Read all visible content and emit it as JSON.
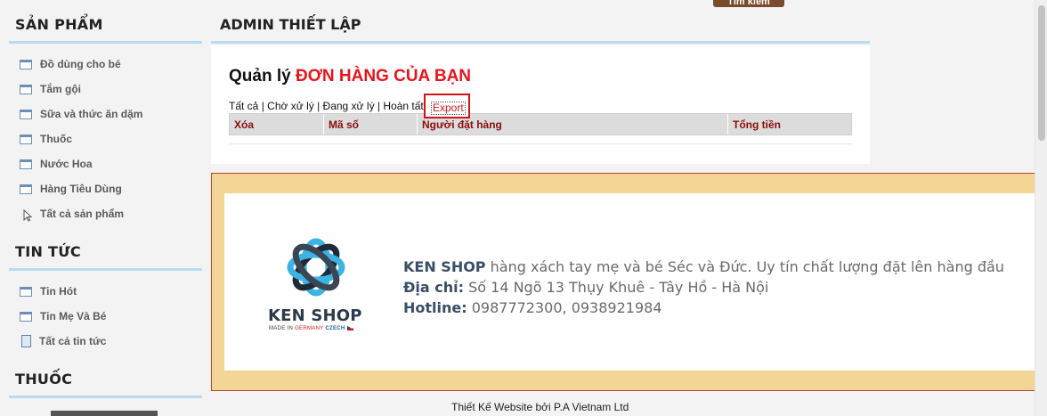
{
  "header": {
    "search_button": "Tìm kiếm"
  },
  "sidebar": {
    "sections": [
      {
        "title": "SẢN PHẨM"
      },
      {
        "title": "TIN TỨC"
      },
      {
        "title": "THUỐC"
      }
    ],
    "products": [
      {
        "label": "Đồ dùng cho bé"
      },
      {
        "label": "Tắm gội"
      },
      {
        "label": "Sữa và thức ăn dặm"
      },
      {
        "label": "Thuốc"
      },
      {
        "label": "Nước Hoa"
      },
      {
        "label": "Hàng Tiêu Dùng"
      }
    ],
    "all_products": "Tất cả sản phẩm",
    "news": [
      {
        "label": "Tin Hót"
      },
      {
        "label": "Tin Mẹ Và Bé"
      }
    ],
    "all_news": "Tất cả tin tức"
  },
  "main": {
    "title": "ADMIN THIẾT LẬP",
    "heading_prefix": "Quản lý",
    "heading_highlight": "ĐƠN HÀNG CỦA BẠN",
    "filters": [
      "Tất cả",
      "Chờ xử lý",
      "Đang xử lý",
      "Hoàn tất"
    ],
    "separator": " | ",
    "export_label": "Export",
    "columns": [
      "Xóa",
      "Mã số",
      "Người đặt hàng",
      "Tổng tiền"
    ]
  },
  "banner": {
    "logo_name": "KEN SHOP",
    "logo_sub_1": "MADE IN",
    "logo_sub_2": "GERMANY",
    "logo_sub_3": "CZECH",
    "shop_name": "KEN SHOP",
    "tagline": " hàng xách tay mẹ và bé Séc và Đức. Uy tín chất lượng đặt lên hàng đầu",
    "address_label": "Địa chỉ:",
    "address": " Số 14 Ngõ 13 Thụy Khuê - Tây Hồ - Hà Nội",
    "hotline_label": "Hotline:",
    "hotline": " 0987772300, 0938921984"
  },
  "footer": {
    "text": "Thiết Kế Website bởi P.A Vietnam Ltd"
  },
  "colors": {
    "accent_red": "#e8141b",
    "section_line": "#b9dbef",
    "banner_bg": "#f3d596",
    "table_header_text": "#8b0d0d"
  }
}
